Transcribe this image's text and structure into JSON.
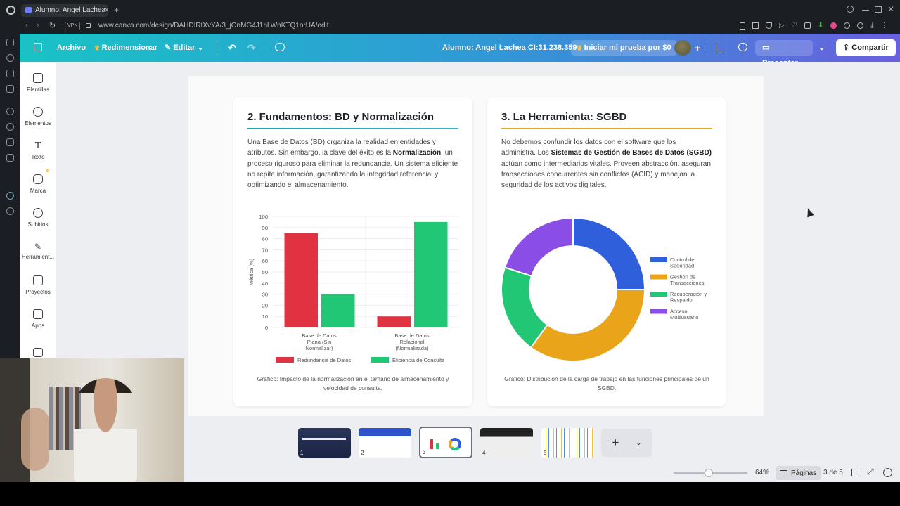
{
  "browser": {
    "tab_title": "Alumno: Angel Lachea CI:3",
    "url": "www.canva.com/design/DAHDIRtXvYA/3_jOnMG4J1pLWnKTQ1orUA/edit",
    "vpn": "VPN"
  },
  "header": {
    "archivo": "Archivo",
    "redimensionar": "Redimensionar",
    "editar": "Editar",
    "doc_title": "Alumno: Angel Lachea CI:31.238.359",
    "trial": "Iniciar mi prueba por $0",
    "presentar": "Presentar",
    "compartir": "Compartir"
  },
  "sidebar": {
    "items": [
      {
        "label": "Plantillas"
      },
      {
        "label": "Elementos"
      },
      {
        "label": "Texto"
      },
      {
        "label": "Marca"
      },
      {
        "label": "Subidos"
      },
      {
        "label": "Herramient..."
      },
      {
        "label": "Proyectos"
      },
      {
        "label": "Apps"
      }
    ]
  },
  "card1": {
    "title": "2. Fundamentos: BD y Normalización",
    "p1": "Una Base de Datos (BD) organiza la realidad en entidades y atributos. Sin embargo, la clave del éxito es la ",
    "bold": "Normalización",
    "p2": ": un proceso riguroso para eliminar la redundancia. Un sistema eficiente no repite información, garantizando la integridad referencial y optimizando el almacenamiento.",
    "caption": "Gráfico: Impacto de la normalización en el tamaño de almacenamiento y velocidad de consulta."
  },
  "card2": {
    "title": "3. La Herramienta: SGBD",
    "p1": "No debemos confundir los datos con el software que los administra. Los ",
    "bold": "Sistemas de Gestión de Bases de Datos (SGBD)",
    "p2": " actúan como intermediarios vitales. Proveen abstracción, aseguran transacciones concurrentes sin conflictos (ACID) y manejan la seguridad de los activos digitales.",
    "caption": "Gráfico: Distribución de la carga de trabajo en las funciones principales de un SGBD."
  },
  "chart_data": [
    {
      "type": "bar",
      "categories": [
        [
          "Base de Datos",
          "Plana (Sin",
          "Normalizar)"
        ],
        [
          "Base de Datos",
          "Relacional",
          "(Normalizada)"
        ]
      ],
      "series": [
        {
          "name": "Redundancia de Datos",
          "color": "#e03342",
          "values": [
            85,
            10
          ]
        },
        {
          "name": "Eficiencia de Consulta",
          "color": "#22c776",
          "values": [
            30,
            95
          ]
        }
      ],
      "ylabel": "Métrica (%)",
      "ylim": [
        0,
        100
      ],
      "yticks": [
        0,
        10,
        20,
        30,
        40,
        50,
        60,
        70,
        80,
        90,
        100
      ],
      "legend": "bottom",
      "grid": true
    },
    {
      "type": "pie",
      "donut": true,
      "labels": [
        [
          "Control de",
          "Seguridad"
        ],
        [
          "Gestión de",
          "Transacciones"
        ],
        [
          "Recuperación y",
          "Respaldo"
        ],
        [
          "Acceso",
          "Multiusuario"
        ]
      ],
      "values": [
        25,
        35,
        20,
        20
      ],
      "colors": [
        "#2f5fdb",
        "#e9a419",
        "#22c776",
        "#8a4de6"
      ],
      "legend": "right"
    }
  ],
  "pages": {
    "thumbs": [
      {
        "num": "1"
      },
      {
        "num": "2"
      },
      {
        "num": "3"
      },
      {
        "num": "4"
      },
      {
        "num": "5"
      }
    ],
    "add": "+"
  },
  "footer": {
    "zoom": "64%",
    "paginas": "Páginas",
    "count": "3 de 5"
  }
}
